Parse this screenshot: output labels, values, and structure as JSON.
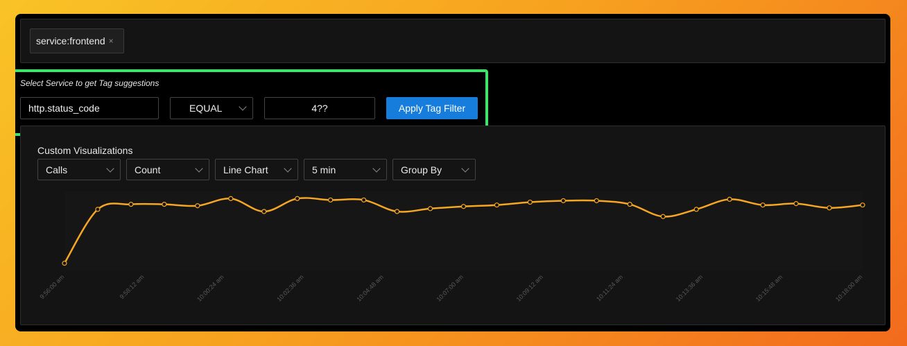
{
  "tag_bar": {
    "chip_label": "service:frontend",
    "chip_close": "×"
  },
  "tag_filter": {
    "hint": "Select Service to get Tag suggestions",
    "key_value": "http.status_code",
    "operator_value": "EQUAL",
    "value": "4??",
    "apply_label": "Apply Tag Filter"
  },
  "visualization": {
    "title": "Custom Visualizations",
    "selects": {
      "entity": "Calls",
      "aggregation": "Count",
      "chart_type": "Line Chart",
      "interval": "5 min",
      "group_by": "Group By"
    }
  },
  "colors": {
    "accent_border": "#3fe36a",
    "primary": "#177ddc",
    "line": "#f5a623"
  },
  "chart_data": {
    "type": "line",
    "title": "",
    "xlabel": "",
    "ylabel": "",
    "grid": false,
    "x_tick_labels": [
      "9:56:00 am",
      "9:58:12 am",
      "10:00:24 am",
      "10:02:36 am",
      "10:04:48 am",
      "10:07:00 am",
      "10:09:12 am",
      "10:11:24 am",
      "10:13:36 am",
      "10:15:48 am",
      "10:18:00 am"
    ],
    "series": [
      {
        "values": [
          10,
          85,
          92,
          92,
          90,
          100,
          82,
          100,
          98,
          98,
          82,
          86,
          89,
          91,
          95,
          97,
          97,
          92,
          75,
          85,
          99,
          91,
          93,
          87,
          91
        ]
      }
    ],
    "ylim": [
      0,
      110
    ]
  }
}
